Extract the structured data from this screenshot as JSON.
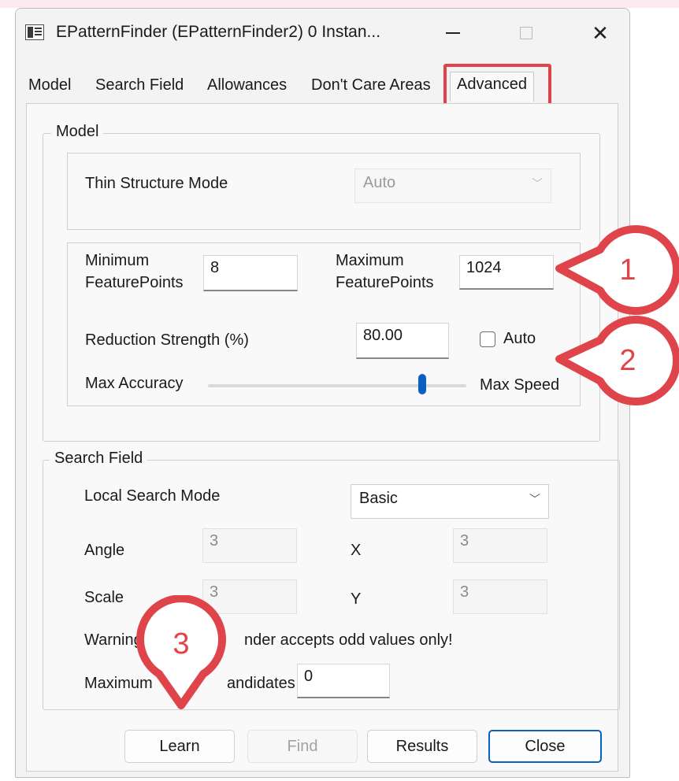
{
  "window": {
    "title": "EPatternFinder (EPatternFinder2) 0 Instan..."
  },
  "tabs": [
    "Model",
    "Search Field",
    "Allowances",
    "Don't Care Areas",
    "Advanced"
  ],
  "model_group": {
    "legend": "Model",
    "thin_structure_label": "Thin Structure Mode",
    "thin_structure_value": "Auto",
    "min_fp_label_1": "Minimum",
    "min_fp_label_2": "FeaturePoints",
    "min_fp_value": "8",
    "max_fp_label_1": "Maximum",
    "max_fp_label_2": "FeaturePoints",
    "max_fp_value": "1024",
    "reduction_label": "Reduction Strength (%)",
    "reduction_value": "80.00",
    "auto_label": "Auto",
    "auto_checked": false,
    "accuracy_label": "Max Accuracy",
    "speed_label": "Max Speed",
    "slider_level": 0.83
  },
  "search_group": {
    "legend": "Search Field",
    "local_mode_label": "Local Search Mode",
    "local_mode_value": "Basic",
    "angle_label": "Angle",
    "angle_value": "3",
    "x_label": "X",
    "x_value": "3",
    "scale_label": "Scale",
    "scale_value": "3",
    "y_label": "Y",
    "y_value": "3",
    "warning_visible": "Warning",
    "warning_tail": "nder accepts odd values only!",
    "max_candidates_visible_1": "Maximum",
    "max_candidates_visible_2": "andidates",
    "max_candidates_value": "0"
  },
  "buttons": {
    "learn": "Learn",
    "find": "Find",
    "results": "Results",
    "close": "Close"
  },
  "callouts": [
    "1",
    "2",
    "3"
  ],
  "colors": {
    "callout": "#e0444b",
    "accent": "#0a5fc4"
  }
}
